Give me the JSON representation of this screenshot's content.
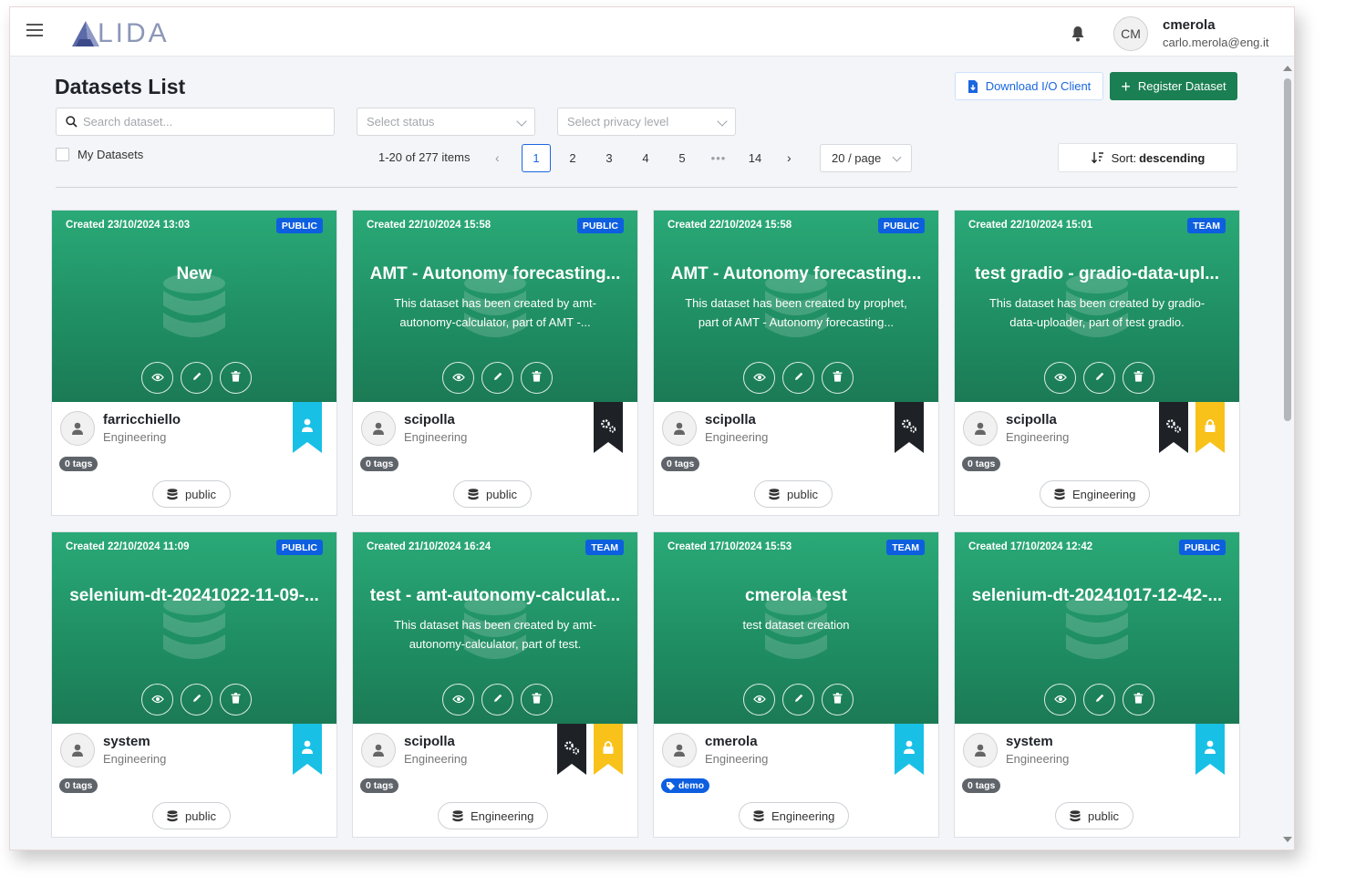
{
  "app": {
    "logo_text": "LIDA",
    "user": {
      "initials": "CM",
      "name": "cmerola",
      "email": "carlo.merola@eng.it"
    }
  },
  "toolbar": {
    "title": "Datasets List",
    "search_placeholder": "Search dataset...",
    "status_placeholder": "Select status",
    "privacy_placeholder": "Select privacy level",
    "download_label": "Download I/O Client",
    "register_label": "Register Dataset",
    "my_datasets_label": "My Datasets",
    "sort_prefix": "Sort:",
    "sort_value": "descending"
  },
  "pagination": {
    "total_label": "1-20 of 277 items",
    "pages": [
      "1",
      "2",
      "3",
      "4",
      "5",
      "•••",
      "14"
    ],
    "current": "1",
    "page_size": "20 / page"
  },
  "colors": {
    "accent": "#1a66e0",
    "primary_green": "#1a7f52",
    "card_green": "#22996b",
    "badge_blue": "#0d5fe0",
    "ribbon_cyan": "#19c0e6",
    "ribbon_black": "#1e2226",
    "ribbon_yellow": "#f8c21b"
  },
  "cards": [
    {
      "created": "Created 23/10/2024 13:03",
      "visibility": "PUBLIC",
      "title": "New",
      "description": "",
      "owner": "farricchiello",
      "org": "Engineering",
      "ribbons": [
        "user"
      ],
      "tags": "0 tags",
      "catalog": "public"
    },
    {
      "created": "Created 22/10/2024 15:58",
      "visibility": "PUBLIC",
      "title": "AMT - Autonomy forecasting...",
      "description": "This dataset has been created by amt-autonomy-calculator, part of AMT -...",
      "owner": "scipolla",
      "org": "Engineering",
      "ribbons": [
        "gears"
      ],
      "tags": "0 tags",
      "catalog": "public"
    },
    {
      "created": "Created 22/10/2024 15:58",
      "visibility": "PUBLIC",
      "title": "AMT - Autonomy forecasting...",
      "description": "This dataset has been created by prophet, part of AMT - Autonomy forecasting...",
      "owner": "scipolla",
      "org": "Engineering",
      "ribbons": [
        "gears"
      ],
      "tags": "0 tags",
      "catalog": "public"
    },
    {
      "created": "Created 22/10/2024 15:01",
      "visibility": "TEAM",
      "title": "test gradio - gradio-data-upl...",
      "description": "This dataset has been created by gradio-data-uploader, part of test gradio.",
      "owner": "scipolla",
      "org": "Engineering",
      "ribbons": [
        "gears",
        "lock"
      ],
      "tags": "0 tags",
      "catalog": "Engineering"
    },
    {
      "created": "Created 22/10/2024 11:09",
      "visibility": "PUBLIC",
      "title": "selenium-dt-20241022-11-09-...",
      "description": "",
      "owner": "system",
      "org": "Engineering",
      "ribbons": [
        "user"
      ],
      "tags": "0 tags",
      "catalog": "public"
    },
    {
      "created": "Created 21/10/2024 16:24",
      "visibility": "TEAM",
      "title": "test - amt-autonomy-calculat...",
      "description": "This dataset has been created by amt-autonomy-calculator, part of test.",
      "owner": "scipolla",
      "org": "Engineering",
      "ribbons": [
        "gears",
        "lock"
      ],
      "tags": "0 tags",
      "catalog": "Engineering"
    },
    {
      "created": "Created 17/10/2024 15:53",
      "visibility": "TEAM",
      "title": "cmerola test",
      "description": "test dataset creation",
      "owner": "cmerola",
      "org": "Engineering",
      "ribbons": [
        "user"
      ],
      "tags": "demo",
      "catalog": "Engineering"
    },
    {
      "created": "Created 17/10/2024 12:42",
      "visibility": "PUBLIC",
      "title": "selenium-dt-20241017-12-42-...",
      "description": "",
      "owner": "system",
      "org": "Engineering",
      "ribbons": [
        "user"
      ],
      "tags": "0 tags",
      "catalog": "public"
    }
  ]
}
